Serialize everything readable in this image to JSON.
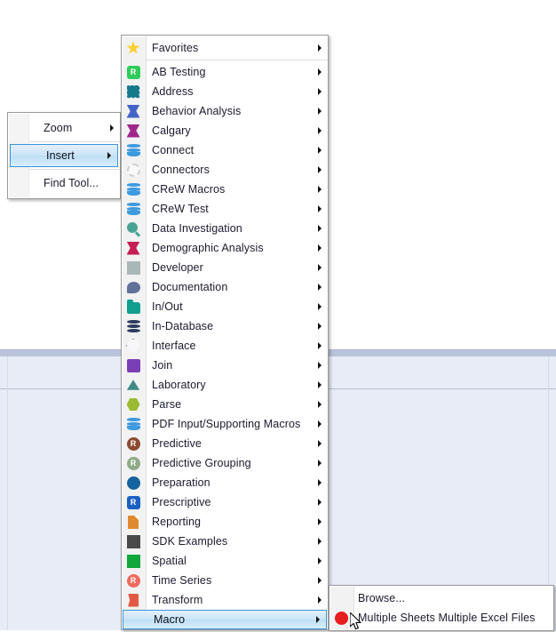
{
  "context_menu": {
    "name": "canvas-context-menu",
    "items": [
      {
        "label": "Zoom",
        "submenu": true,
        "highlighted": false,
        "separator_after": true
      },
      {
        "label": "Insert",
        "submenu": true,
        "highlighted": true,
        "separator_after": true
      },
      {
        "label": "Find Tool...",
        "submenu": false,
        "highlighted": false,
        "separator_after": false
      }
    ]
  },
  "tool_menu": {
    "name": "insert-tool-category-menu",
    "items": [
      {
        "label": "Favorites",
        "icon": "star-icon",
        "color": "#ffcf2e",
        "shape": "star",
        "separator_after": true
      },
      {
        "label": "AB Testing",
        "icon": "r-badge-green-icon",
        "color": "#2ecc5a",
        "shape": "rbadge-square",
        "text": "R"
      },
      {
        "label": "Address",
        "icon": "address-square-icon",
        "color": "#157a8c",
        "shape": "burst-square"
      },
      {
        "label": "Behavior Analysis",
        "icon": "bowtie-blue-icon",
        "color": "#4464c8",
        "shape": "bowtie"
      },
      {
        "label": "Calgary",
        "icon": "bowtie-magenta-icon",
        "color": "#a0268c",
        "shape": "bowtie"
      },
      {
        "label": "Connect",
        "icon": "cylinder-blue-icon",
        "color": "#3b9ae0",
        "shape": "cylinder"
      },
      {
        "label": "Connectors",
        "icon": "dotted-ring-icon",
        "color": "#cfcfcf",
        "shape": "dotring"
      },
      {
        "label": "CReW Macros",
        "icon": "cylinder-blue-icon",
        "color": "#3b9ae0",
        "shape": "cylinder"
      },
      {
        "label": "CReW Test",
        "icon": "cylinder-blue-icon",
        "color": "#3b9ae0",
        "shape": "cylinder"
      },
      {
        "label": "Data Investigation",
        "icon": "magnifier-teal-icon",
        "color": "#49a394",
        "shape": "magnifier"
      },
      {
        "label": "Demographic Analysis",
        "icon": "bowtie-crimson-icon",
        "color": "#c41e54",
        "shape": "bowtie"
      },
      {
        "label": "Developer",
        "icon": "gear-burst-gray-icon",
        "color": "#a9b8b6",
        "shape": "burst"
      },
      {
        "label": "Documentation",
        "icon": "speech-bubble-icon",
        "color": "#62719a",
        "shape": "bubble"
      },
      {
        "label": "In/Out",
        "icon": "folder-teal-icon",
        "color": "#109e8e",
        "shape": "folder"
      },
      {
        "label": "In-Database",
        "icon": "database-stack-icon",
        "color": "#2b3a5e",
        "shape": "dbstack"
      },
      {
        "label": "Interface",
        "icon": "diamond-outline-icon",
        "color": "#8d8d99",
        "shape": "diamond-outline"
      },
      {
        "label": "Join",
        "icon": "square-purple-icon",
        "color": "#7b3fb5",
        "shape": "square"
      },
      {
        "label": "Laboratory",
        "icon": "triangle-teal-icon",
        "color": "#3f8a86",
        "shape": "triangle"
      },
      {
        "label": "Parse",
        "icon": "hexagon-olive-icon",
        "color": "#9aba32",
        "shape": "hexagon"
      },
      {
        "label": "PDF Input/Supporting Macros",
        "icon": "cylinder-blue-icon",
        "color": "#3b9ae0",
        "shape": "cylinder"
      },
      {
        "label": "Predictive",
        "icon": "r-badge-brown-icon",
        "color": "#8c4a30",
        "shape": "rbadge-circle",
        "text": "R"
      },
      {
        "label": "Predictive Grouping",
        "icon": "r-badge-sage-icon",
        "color": "#8faa86",
        "shape": "rbadge-circle",
        "text": "R"
      },
      {
        "label": "Preparation",
        "icon": "circle-blue-icon",
        "color": "#15639e",
        "shape": "circle"
      },
      {
        "label": "Prescriptive",
        "icon": "r-badge-blue-icon",
        "color": "#1a5fc4",
        "shape": "rbadge-square",
        "text": "R"
      },
      {
        "label": "Reporting",
        "icon": "page-orange-icon",
        "color": "#e08a30",
        "shape": "page"
      },
      {
        "label": "SDK Examples",
        "icon": "gear-burst-dark-icon",
        "color": "#4a4a4a",
        "shape": "burst"
      },
      {
        "label": "Spatial",
        "icon": "burst-green-icon",
        "color": "#10a83a",
        "shape": "burst"
      },
      {
        "label": "Time Series",
        "icon": "r-badge-salmon-icon",
        "color": "#ef6a5c",
        "shape": "rbadge-circle",
        "text": "R"
      },
      {
        "label": "Transform",
        "icon": "transform-red-icon",
        "color": "#e25a41",
        "shape": "transform"
      },
      {
        "label": "Macro",
        "icon": "none",
        "color": "",
        "shape": "none",
        "highlighted": true
      }
    ]
  },
  "macro_submenu": {
    "name": "macro-submenu",
    "items": [
      {
        "label": "Browse...",
        "icon": "none",
        "color": "",
        "shape": "none"
      },
      {
        "label": "Multiple Sheets Multiple Excel Files",
        "icon": "circle-red-icon",
        "color": "#e81d1d",
        "shape": "circle"
      }
    ]
  },
  "colors": {
    "highlight_border": "#3c92d4",
    "highlight_fill": "#c9e4f8",
    "menu_border": "#9a9a9a",
    "menu_background": "#ffffff",
    "gutter": "#f2f2f2",
    "text": "#1a1a2e",
    "app_panel": "#e8ecf7"
  }
}
